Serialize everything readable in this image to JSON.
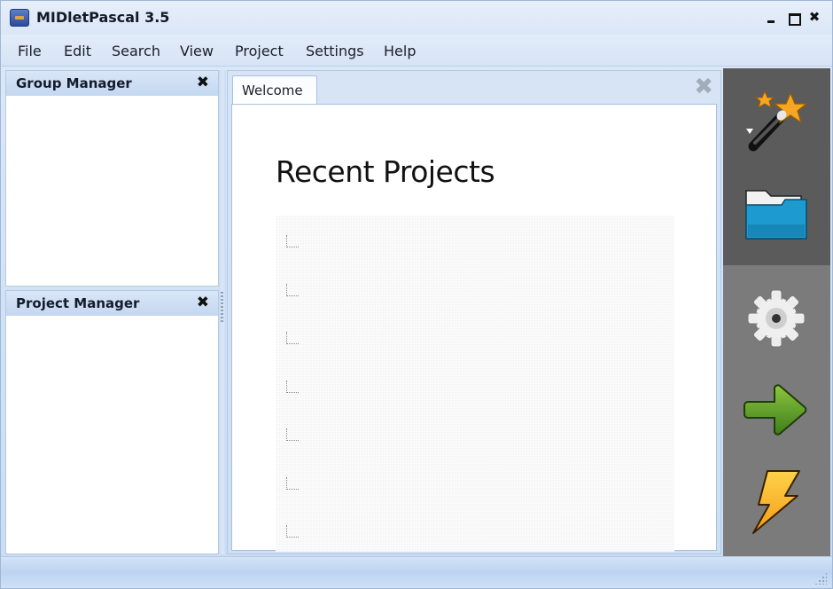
{
  "window": {
    "title": "MIDletPascal 3.5",
    "controls": {
      "minimize": "minimize",
      "maximize": "maximize",
      "close": "✖"
    }
  },
  "menu": {
    "items": [
      {
        "label": "File"
      },
      {
        "label": "Edit"
      },
      {
        "label": "Search"
      },
      {
        "label": "View"
      },
      {
        "label": "Project"
      },
      {
        "label": "Settings"
      },
      {
        "label": "Help"
      }
    ]
  },
  "left_dock": {
    "group_manager": {
      "title": "Group Manager",
      "close": "✖"
    },
    "project_manager": {
      "title": "Project Manager",
      "close": "✖"
    }
  },
  "document": {
    "tabs": [
      {
        "label": "Welcome",
        "active": true
      }
    ],
    "close": "✖",
    "welcome": {
      "heading": "Recent Projects",
      "recent_projects": [
        {
          "label": ""
        },
        {
          "label": ""
        },
        {
          "label": ""
        },
        {
          "label": ""
        },
        {
          "label": ""
        },
        {
          "label": ""
        },
        {
          "label": ""
        }
      ]
    }
  },
  "toolbar": {
    "buttons": [
      {
        "name": "new-project-wizard",
        "icon": "magic-wand-icon",
        "has_dropdown": true
      },
      {
        "name": "open-project",
        "icon": "folder-icon"
      },
      {
        "name": "build-settings",
        "icon": "gear-icon"
      },
      {
        "name": "run",
        "icon": "arrow-right-icon"
      },
      {
        "name": "build",
        "icon": "lightning-icon"
      }
    ],
    "colors": {
      "top_section": "#5b5b5b",
      "bottom_section": "#7b7b7b"
    }
  },
  "statusbar": {
    "text": ""
  }
}
